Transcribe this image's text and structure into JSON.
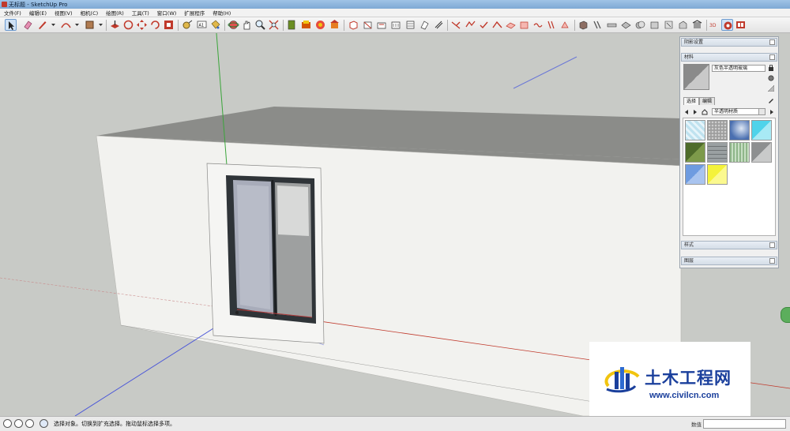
{
  "window": {
    "title": "无标题 - SketchUp Pro"
  },
  "menu": [
    "文件(F)",
    "编辑(E)",
    "视图(V)",
    "相机(C)",
    "绘图(R)",
    "工具(T)",
    "窗口(W)",
    "扩展程序",
    "帮助(H)"
  ],
  "toolbar": {
    "tools": [
      "select-tool",
      "eraser-tool",
      "line-tool",
      "arc-tool",
      "rectangle-tool",
      "push-pull-tool",
      "follow-me-tool",
      "move-tool",
      "rotate-tool",
      "scale-tool",
      "tape-measure-tool",
      "text-tool",
      "paint-bucket-tool",
      "orbit-tool",
      "pan-tool",
      "zoom-tool",
      "zoom-extents-tool",
      "components-tool",
      "materials-tool",
      "styles-tool",
      "iso-view",
      "top-view",
      "front-view",
      "right-view",
      "back-view",
      "left-view",
      "section-plane-tool",
      "display-section",
      "sandbox-tool",
      "smoove-tool",
      "stamp-tool",
      "drape-tool",
      "add-detail-tool",
      "flip-edge-tool",
      "solid-union",
      "solid-subtract",
      "solid-trim",
      "solid-split",
      "warehouse-tool",
      "extension-warehouse",
      "ruby-console",
      "layout-tool"
    ]
  },
  "panel": {
    "sections": {
      "shadow": "阴影设置",
      "materials": "材料",
      "styles": "样式",
      "layers": "图层"
    },
    "material_name": "灰色半透明玻璃",
    "tabs": [
      "选择",
      "编辑"
    ],
    "library": "半透明材质",
    "swatch_colors": [
      "#bfe2ef",
      "#a9a9a9",
      "#4a6fb0",
      "#4fd3ea",
      "#4e6b2a",
      "#9aa0a2",
      "#8fb68a",
      "#8d8f90",
      "#6e9be0",
      "#f4f23a"
    ]
  },
  "status": {
    "message": "选择对象。切换到扩充选择。拖动鼠标选择多项。",
    "vcb_label": "数值"
  },
  "watermark": {
    "title": "土木工程网",
    "url": "www.civilcn.com"
  },
  "colors": {
    "background": "#c9cbc8",
    "wall": "#f2f2ef",
    "roof": "#8b8c89",
    "accent": "#1a3f9c"
  }
}
